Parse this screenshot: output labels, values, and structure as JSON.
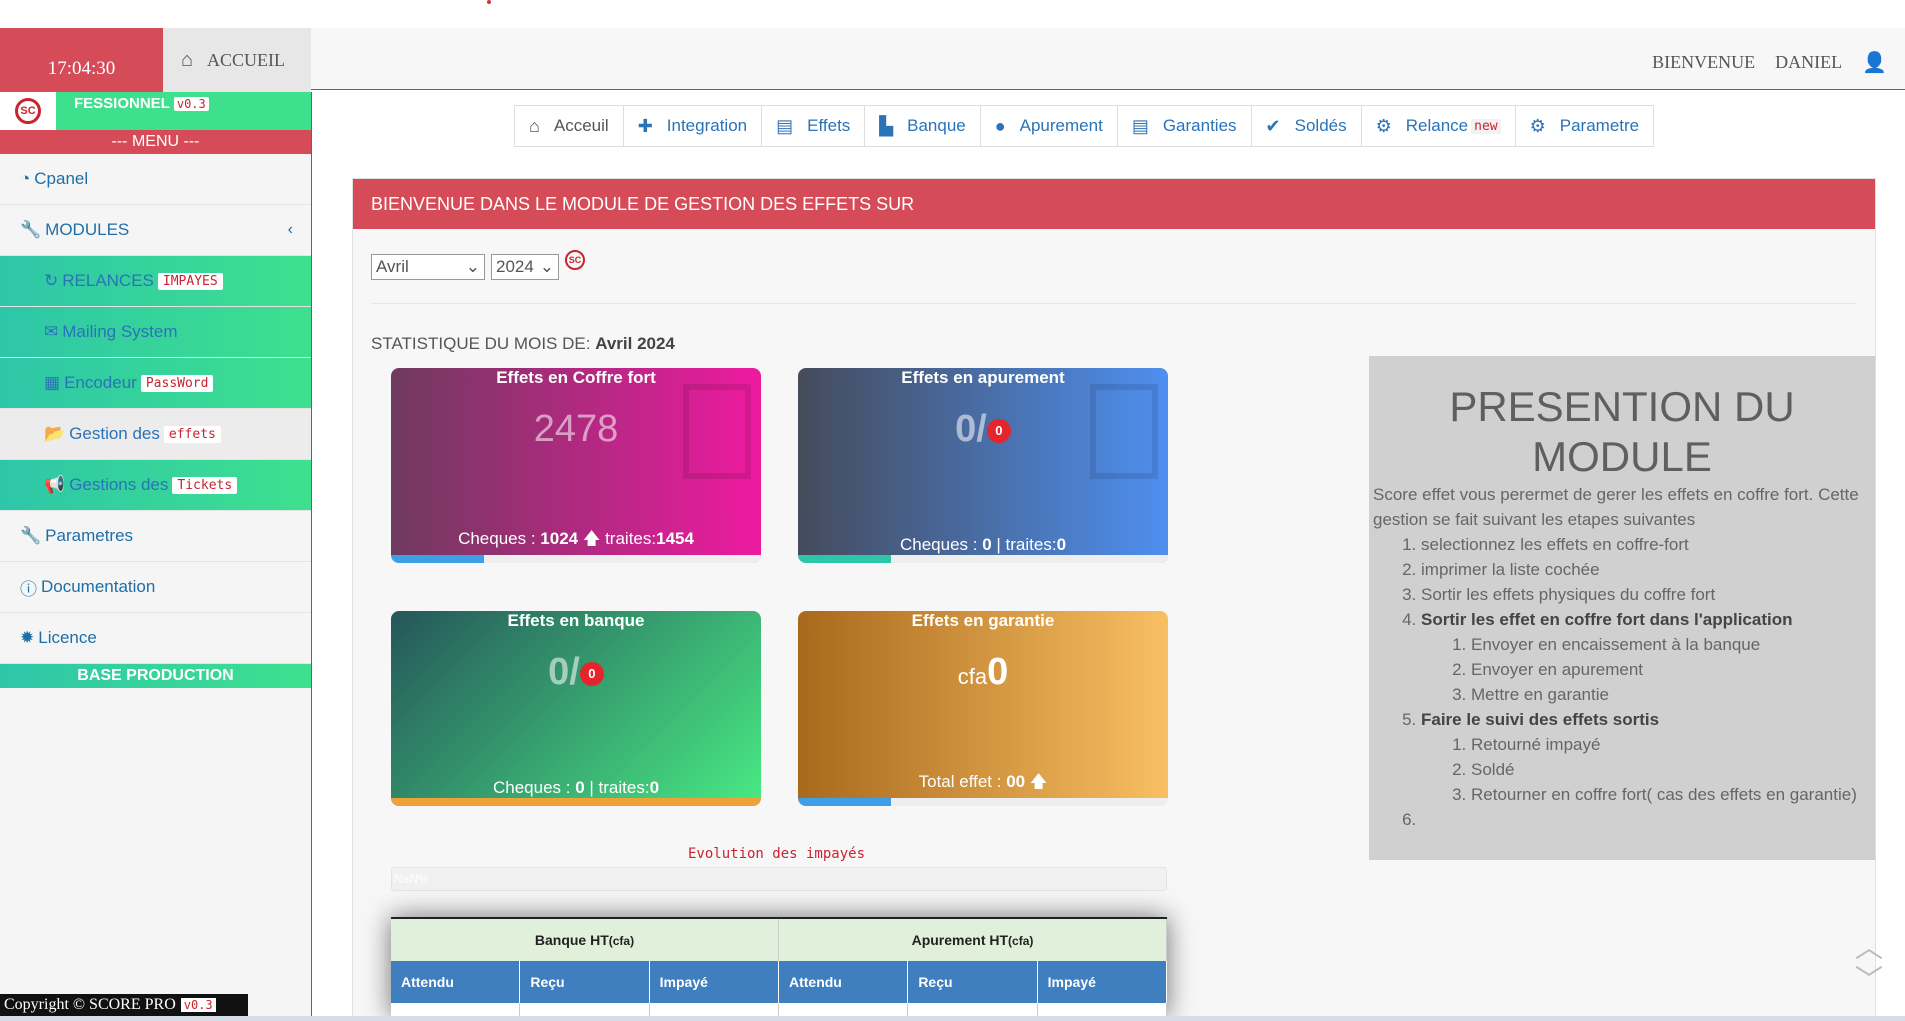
{
  "header": {
    "clock": "17:04:30",
    "home_label": "ACCUEIL",
    "welcome": "BIENVENUE",
    "username": "DANIEL"
  },
  "sidebar": {
    "brand_name": "FESSIONNEL",
    "brand_version": "v0.3",
    "menu_title": "--- MENU ---",
    "items": {
      "cpanel": "Cpanel",
      "modules": "MODULES",
      "relances": "RELANCES",
      "relances_tag": "IMPAYES",
      "mailing": "Mailing System",
      "encodeur": "Encodeur",
      "encodeur_tag": "PassWord",
      "gestion_effets": "Gestion des",
      "gestion_effets_tag": "effets",
      "gestion_tickets": "Gestions des",
      "gestion_tickets_tag": "Tickets",
      "parametres": "Parametres",
      "documentation": "Documentation",
      "licence": "Licence"
    },
    "base": "BASE PRODUCTION",
    "copyright": "Copyright © SCORE PRO",
    "copyright_version": "v0.3"
  },
  "tabs": [
    {
      "label": "Acceuil",
      "icon": "home-icon"
    },
    {
      "label": "Integration",
      "icon": "plus-icon"
    },
    {
      "label": "Effets",
      "icon": "file-icon"
    },
    {
      "label": "Banque",
      "icon": "bank-icon"
    },
    {
      "label": "Apurement",
      "icon": "piggy-icon"
    },
    {
      "label": "Garanties",
      "icon": "file-icon"
    },
    {
      "label": "Soldés",
      "icon": "check-icon"
    },
    {
      "label": "Relance",
      "icon": "gear-icon",
      "tag": "new"
    },
    {
      "label": "Parametre",
      "icon": "gear-icon"
    }
  ],
  "main": {
    "title": "BIENVENUE DANS LE MODULE DE GESTION DES EFFETS SUR",
    "month_select": "Avril",
    "year_select": "2024",
    "stat_prefix": "STATISTIQUE DU MOIS DE:",
    "stat_period": "Avril 2024",
    "cards": [
      {
        "title": "Effets en Coffre fort",
        "value": "2478",
        "foot_label": "Cheques :",
        "cheques": "1024",
        "traites_label": "traites:",
        "traites": "1454",
        "progress_fraction": 0.25,
        "bar_color": "#3f9ee8"
      },
      {
        "title": "Effets en apurement",
        "value": "0/",
        "badge": "0",
        "foot_label": "Cheques :",
        "cheques": "0",
        "traites_label": "| traites:",
        "traites": "0",
        "progress_fraction": 0.25,
        "bar_color": "#2ec6a8"
      },
      {
        "title": "Effets en banque",
        "value": "0/",
        "badge": "0",
        "foot_label": "Cheques :",
        "cheques": "0",
        "traites_label": "| traites:",
        "traites": "0",
        "progress_fraction": 1.0,
        "bar_color": "#f0a23a"
      },
      {
        "title": "Effets en garantie",
        "prefix": "cfa",
        "value": "0",
        "foot_label": "Total effet :",
        "total": "00",
        "progress_fraction": 0.25,
        "bar_color": "#3f9ee8"
      }
    ],
    "evolution_title": "Evolution des impayés",
    "progress_text": "NaN%",
    "table": {
      "group1": "Banque HT",
      "group1_unit": "(cfa)",
      "group2": "Apurement HT",
      "group2_unit": "(cfa)",
      "columns": [
        "Attendu",
        "Reçu",
        "Impayé",
        "Attendu",
        "Reçu",
        "Impayé"
      ]
    }
  },
  "presentation": {
    "title": "PRESENTION DU MODULE",
    "intro": "Score effet vous perermet de gerer les effets en coffre fort. Cette gestion se fait suivant les etapes suivantes",
    "steps": [
      "selectionnez les effets en coffre-fort",
      "imprimer la liste cochée",
      "Sortir les effets physiques du coffre fort",
      "Sortir les effet en coffre fort dans l'application",
      "Faire le suivi des effets sortis"
    ],
    "step4_sub": [
      "Envoyer en encaissement à la banque",
      "Envoyer en apurement",
      "Mettre en garantie"
    ],
    "step5_sub": [
      "Retourné impayé",
      "Soldé",
      "Retourner en coffre fort( cas des effets en garantie)"
    ]
  }
}
